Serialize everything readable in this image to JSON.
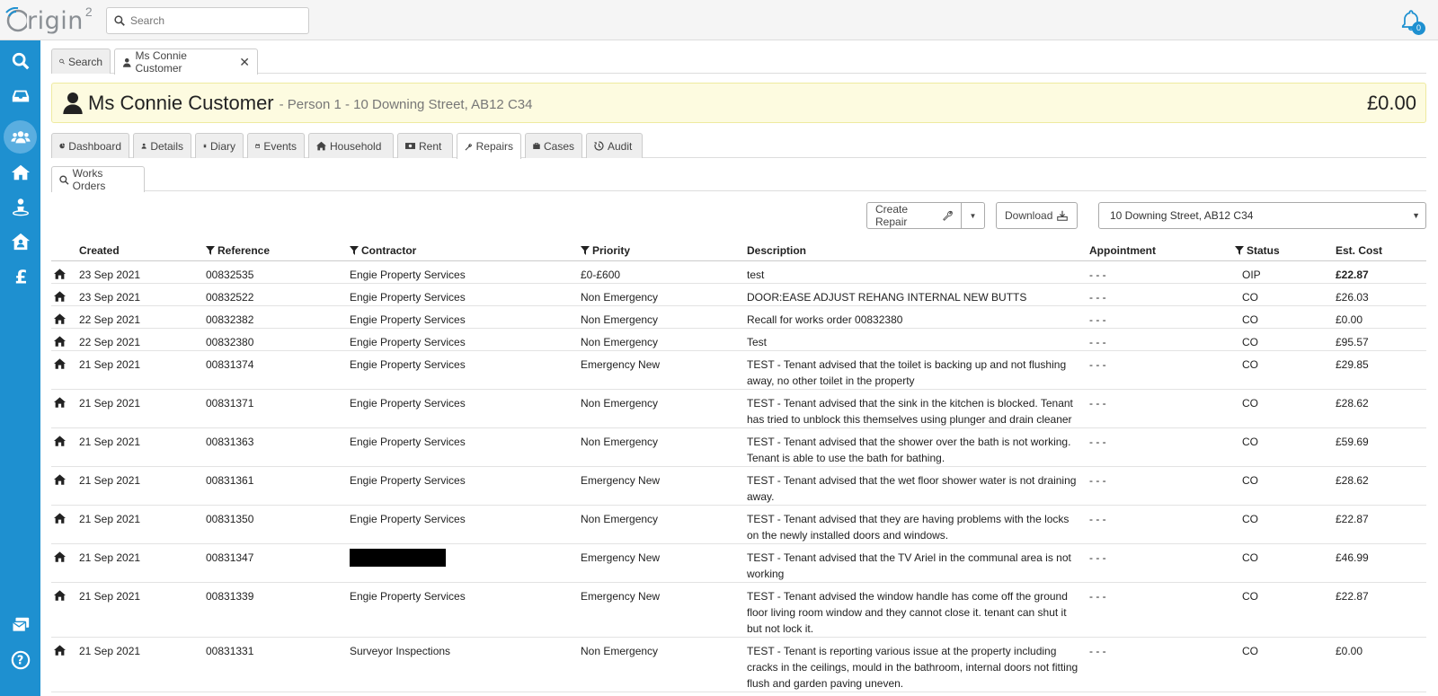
{
  "app": {
    "logo_text": "rigin",
    "logo_sup": "2",
    "notifications": "0"
  },
  "search": {
    "placeholder": "Search"
  },
  "top_tabs": [
    {
      "label": "Search"
    },
    {
      "label": "Ms Connie Customer"
    }
  ],
  "header": {
    "name": "Ms Connie Customer",
    "subtitle": "- Person 1 - 10 Downing Street, AB12 C34",
    "balance": "£0.00"
  },
  "section_tabs": [
    {
      "label": "Dashboard",
      "icon": "dashboard-icon"
    },
    {
      "label": "Details",
      "icon": "user-icon"
    },
    {
      "label": "Diary",
      "icon": "book-icon"
    },
    {
      "label": "Events",
      "icon": "calendar-icon"
    },
    {
      "label": "Household",
      "icon": "home-icon"
    },
    {
      "label": "Rent",
      "icon": "money-icon"
    },
    {
      "label": "Repairs",
      "icon": "wrench-icon"
    },
    {
      "label": "Cases",
      "icon": "briefcase-icon"
    },
    {
      "label": "Audit",
      "icon": "history-icon"
    }
  ],
  "sub_tab": {
    "label": "Works Orders"
  },
  "toolbar": {
    "create_repair": "Create Repair",
    "download": "Download",
    "address_select": "10 Downing Street, AB12 C34"
  },
  "table": {
    "headers": {
      "created": "Created",
      "reference": "Reference",
      "contractor": "Contractor",
      "priority": "Priority",
      "description": "Description",
      "appointment": "Appointment",
      "status": "Status",
      "cost": "Est. Cost"
    },
    "rows": [
      {
        "created": "23 Sep 2021",
        "reference": "00832535",
        "contractor": "Engie Property Services",
        "priority": "£0-£600",
        "description": "test",
        "appointment": "- - -",
        "status": "OIP",
        "cost": "£22.87"
      },
      {
        "created": "23 Sep 2021",
        "reference": "00832522",
        "contractor": "Engie Property Services",
        "priority": "Non Emergency",
        "description": "DOOR:EASE ADJUST REHANG INTERNAL NEW BUTTS",
        "appointment": "- - -",
        "status": "CO",
        "cost": "£26.03"
      },
      {
        "created": "22 Sep 2021",
        "reference": "00832382",
        "contractor": "Engie Property Services",
        "priority": "Non Emergency",
        "description": "Recall for works order 00832380",
        "appointment": "- - -",
        "status": "CO",
        "cost": "£0.00"
      },
      {
        "created": "22 Sep 2021",
        "reference": "00832380",
        "contractor": "Engie Property Services",
        "priority": "Non Emergency",
        "description": "Test",
        "appointment": "- - -",
        "status": "CO",
        "cost": "£95.57"
      },
      {
        "created": "21 Sep 2021",
        "reference": "00831374",
        "contractor": "Engie Property Services",
        "priority": "Emergency New",
        "description": "TEST - Tenant advised that the toilet is backing up and not flushing away, no other toilet in the property",
        "appointment": "- - -",
        "status": "CO",
        "cost": "£29.85"
      },
      {
        "created": "21 Sep 2021",
        "reference": "00831371",
        "contractor": "Engie Property Services",
        "priority": "Non Emergency",
        "description": "TEST - Tenant advised that the sink in the kitchen is blocked. Tenant has tried to unblock this themselves using plunger and drain cleaner",
        "appointment": "- - -",
        "status": "CO",
        "cost": "£28.62"
      },
      {
        "created": "21 Sep 2021",
        "reference": "00831363",
        "contractor": "Engie Property Services",
        "priority": "Non Emergency",
        "description": "TEST - Tenant advised that the shower over the bath is not working. Tenant is able to use the bath for bathing.",
        "appointment": "- - -",
        "status": "CO",
        "cost": "£59.69"
      },
      {
        "created": "21 Sep 2021",
        "reference": "00831361",
        "contractor": "Engie Property Services",
        "priority": "Emergency New",
        "description": "TEST - Tenant advised that the wet floor shower water is not draining away.",
        "appointment": "- - -",
        "status": "CO",
        "cost": "£28.62"
      },
      {
        "created": "21 Sep 2021",
        "reference": "00831350",
        "contractor": "Engie Property Services",
        "priority": "Non Emergency",
        "description": "TEST - Tenant advised that they are having problems with the locks on the newly installed doors and windows.",
        "appointment": "- - -",
        "status": "CO",
        "cost": "£22.87"
      },
      {
        "created": "21 Sep 2021",
        "reference": "00831347",
        "contractor": "",
        "priority": "Emergency New",
        "description": "TEST - Tenant advised that the TV Ariel in the communal area is not working",
        "appointment": "- - -",
        "status": "CO",
        "cost": "£46.99"
      },
      {
        "created": "21 Sep 2021",
        "reference": "00831339",
        "contractor": "Engie Property Services",
        "priority": "Emergency New",
        "description": "TEST - Tenant advised the window handle has come off the ground floor living room window and they cannot close it. tenant can shut it but not lock it.",
        "appointment": "- - -",
        "status": "CO",
        "cost": "£22.87"
      },
      {
        "created": "21 Sep 2021",
        "reference": "00831331",
        "contractor": "Surveyor Inspections",
        "priority": "Non Emergency",
        "description": "TEST - Tenant is reporting various issue at the property including cracks in the ceilings, mould in the bathroom, internal doors not fitting flush and garden paving uneven.",
        "appointment": "- - -",
        "status": "CO",
        "cost": "£0.00"
      }
    ]
  },
  "colors": {
    "sidebar": "#1e90d0",
    "header_bg": "#fdfbe0"
  }
}
